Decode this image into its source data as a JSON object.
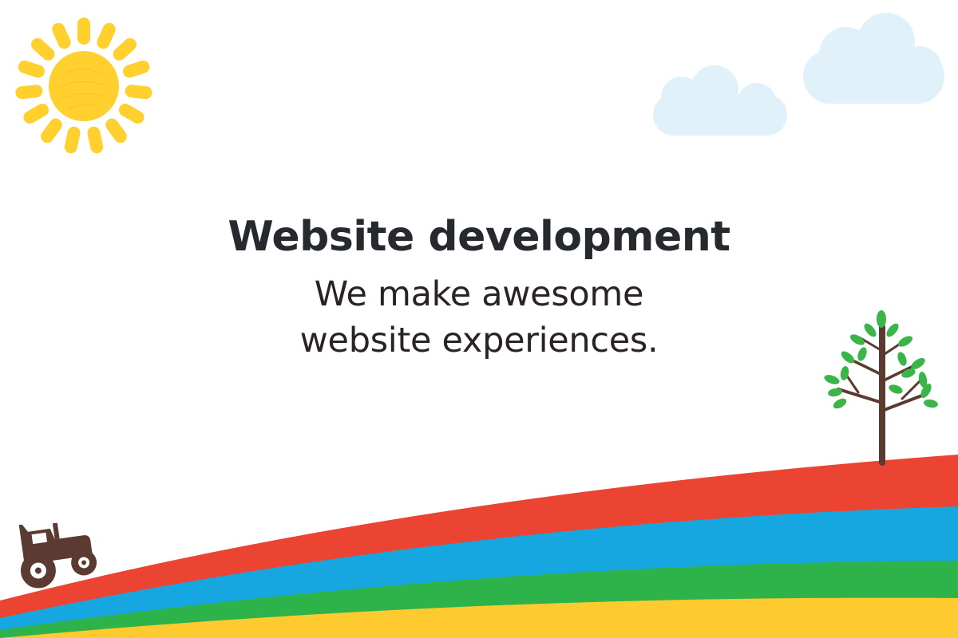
{
  "hero": {
    "title": "Website development",
    "subtitle_line1": "We make awesome",
    "subtitle_line2": "website experiences."
  },
  "illustration": {
    "icons": [
      "sun-icon",
      "cloud-icon",
      "tree-icon",
      "tractor-icon"
    ],
    "colors": {
      "sun": "#FFD02E",
      "cloud": "#E1F1FA",
      "hill_red": "#EB4432",
      "hill_blue": "#17A7E0",
      "hill_green": "#2DB34A",
      "hill_yellow": "#FDCB2F",
      "tree_trunk": "#5B3A31",
      "tree_leaves": "#3BB54A",
      "tractor": "#5B3A31",
      "title_text": "#262A2F"
    }
  }
}
